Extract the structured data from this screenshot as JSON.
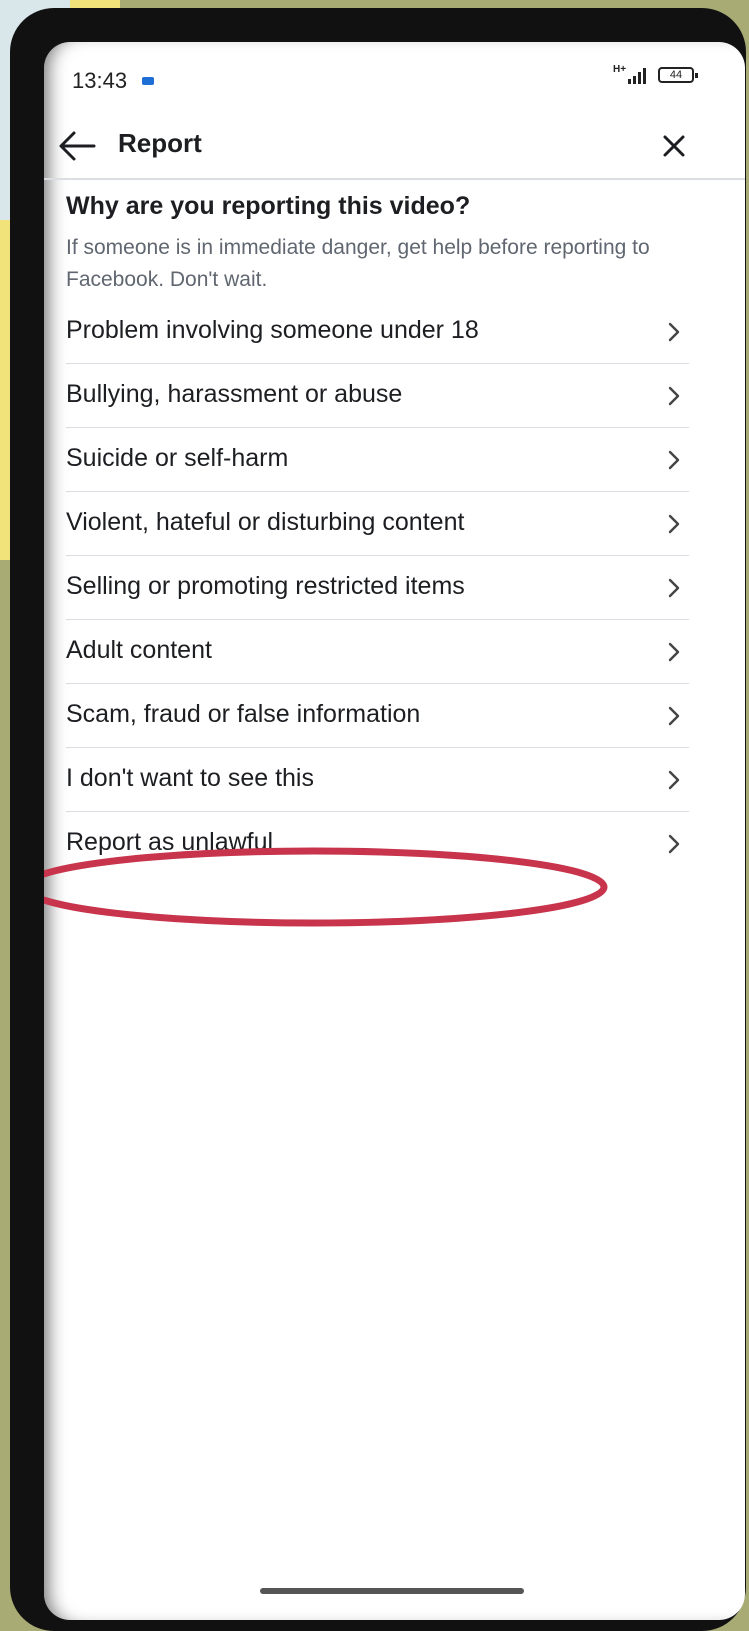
{
  "status_bar": {
    "time": "13:43",
    "network": "H+",
    "battery": "44"
  },
  "header": {
    "title": "Report"
  },
  "prompt": {
    "heading": "Why are you reporting this video?",
    "subtext": "If someone is in immediate danger, get help before reporting to Facebook. Don't wait."
  },
  "options": [
    {
      "label": "Problem involving someone under 18"
    },
    {
      "label": "Bullying, harassment or abuse"
    },
    {
      "label": "Suicide or self-harm"
    },
    {
      "label": "Violent, hateful or disturbing content"
    },
    {
      "label": "Selling or promoting restricted items"
    },
    {
      "label": "Adult content"
    },
    {
      "label": "Scam, fraud or false information"
    },
    {
      "label": "I don't want to see this"
    },
    {
      "label": "Report as unlawful"
    }
  ],
  "highlight": {
    "target": "Report as unlawful",
    "color": "#c8344c"
  },
  "colors": {
    "background": "#a8ab74",
    "frame": "#111111",
    "text_primary": "#1c1e21",
    "text_secondary": "#606770",
    "divider": "#dadde1"
  }
}
